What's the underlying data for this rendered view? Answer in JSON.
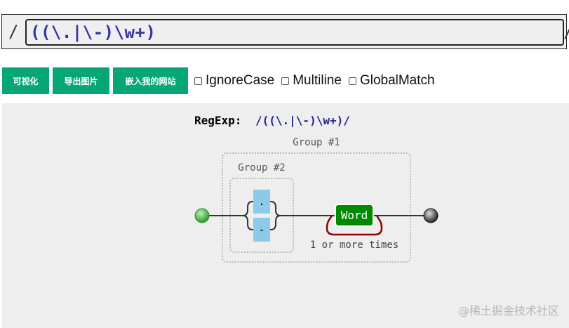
{
  "regex_bar": {
    "left_delimiter": "/",
    "right_delimiter": "/",
    "value": "((\\.|\\-)\\w+)"
  },
  "toolbar": {
    "visualize_label": "可视化",
    "export_label": "导出图片",
    "embed_label": "嵌入我的网站",
    "options": [
      {
        "label": "IgnoreCase",
        "checked": false
      },
      {
        "label": "Multiline",
        "checked": false
      },
      {
        "label": "GlobalMatch",
        "checked": false
      }
    ]
  },
  "diagram": {
    "title_prefix": "RegExp:",
    "title_regex": "/((\\.|\\-)\\w+)/",
    "group1_label": "Group #1",
    "group2_label": "Group #2",
    "char_dot": ".",
    "char_dash": "-",
    "word_label": "Word",
    "repeat_label": "1 or more times",
    "colors": {
      "literal": "#8ec9ea",
      "word": "#008a00",
      "loop": "#8b0000",
      "start": "#3cb83c",
      "end": "#333333"
    }
  },
  "watermark": "@稀土掘金技术社区"
}
